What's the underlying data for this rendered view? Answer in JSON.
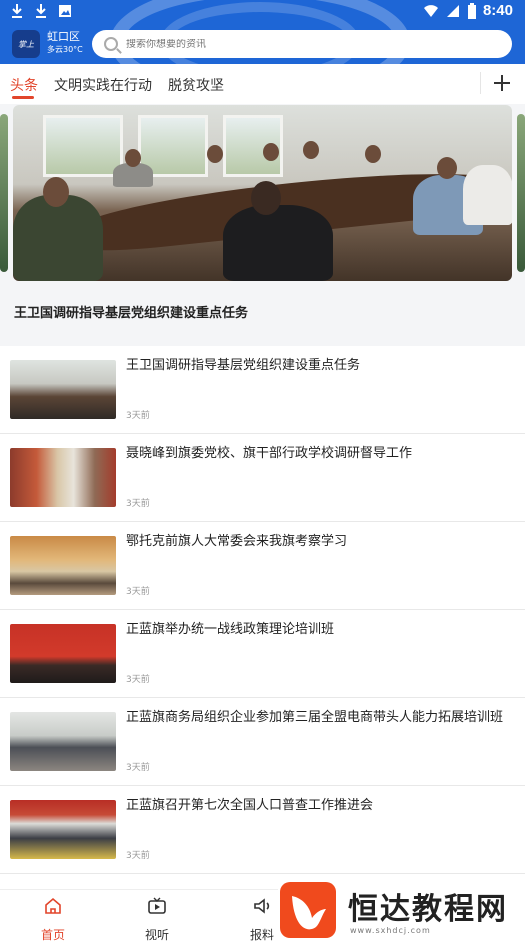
{
  "status_bar": {
    "time": "8:40",
    "left_icons": [
      "download-icon",
      "download-icon",
      "image-icon"
    ],
    "right_icons": [
      "wifi-icon",
      "signal-icon",
      "battery-icon"
    ]
  },
  "header": {
    "location_city": "虹口区",
    "weather": "多云30°C",
    "search_placeholder": "搜索你想要的资讯",
    "brand_color": "#1e66d6"
  },
  "tabs": {
    "items": [
      {
        "label": "头条",
        "active": true
      },
      {
        "label": "文明实践在行动",
        "active": false
      },
      {
        "label": "脱贫攻坚",
        "active": false
      }
    ],
    "add_icon": "plus-icon",
    "accent_color": "#e2452b"
  },
  "banner": {
    "title": "王卫国调研指导基层党组织建设重点任务"
  },
  "news": [
    {
      "title": "王卫国调研指导基层党组织建设重点任务",
      "time": "3天前"
    },
    {
      "title": "聂晓峰到旗委党校、旗干部行政学校调研督导工作",
      "time": "3天前"
    },
    {
      "title": "鄂托克前旗人大常委会来我旗考察学习",
      "time": "3天前"
    },
    {
      "title": "正蓝旗举办统一战线政策理论培训班",
      "time": "3天前"
    },
    {
      "title": "正蓝旗商务局组织企业参加第三届全盟电商带头人能力拓展培训班",
      "time": "3天前"
    },
    {
      "title": "正蓝旗召开第七次全国人口普查工作推进会",
      "time": "3天前"
    }
  ],
  "bottom_nav": [
    {
      "label": "首页",
      "icon": "home-icon",
      "active": true
    },
    {
      "label": "视听",
      "icon": "video-icon",
      "active": false
    },
    {
      "label": "报料",
      "icon": "sound-icon",
      "active": false
    }
  ],
  "watermark": {
    "text": "恒达教程网",
    "url": "www.sxhdcj.com"
  }
}
